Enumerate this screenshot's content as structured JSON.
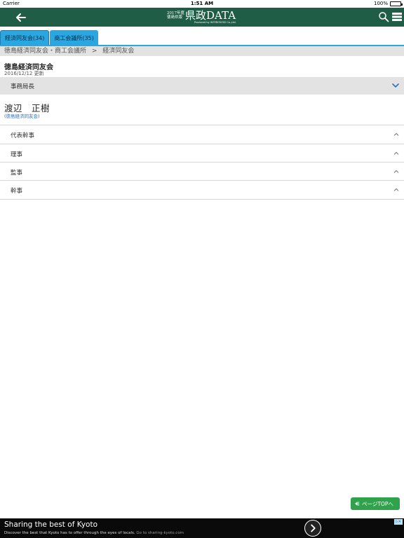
{
  "status": {
    "carrier": "Carrier",
    "time": "1:51 AM",
    "battery": "100%"
  },
  "header": {
    "logo_small_line1": "2017年度",
    "logo_small_line2": "徳島県版",
    "logo_big": "県政DATA",
    "logo_produced": "Produced by INTERCROSS Co.,Ltd."
  },
  "tabs": [
    {
      "label": "経済同友会(34)"
    },
    {
      "label": "商工会議所(35)"
    }
  ],
  "breadcrumb": {
    "parent": "徳島経済同友会・商工会議所",
    "separator": ">",
    "current": "経済同友会"
  },
  "org": {
    "title": "徳島経済同友会",
    "updated": "2016/12/12 更新"
  },
  "expanded_section": {
    "label": "事務局長",
    "person_name": "渡辺　正樹",
    "person_org_open": "(",
    "person_org_link": "徳島経済同友会",
    "person_org_close": ")"
  },
  "sections": [
    {
      "label": "代表幹事"
    },
    {
      "label": "理事"
    },
    {
      "label": "監事"
    },
    {
      "label": "幹事"
    }
  ],
  "page_top_label": "ページTOPへ",
  "ad": {
    "title": "Sharing the best of Kyoto",
    "desc": "Discover the best that Kyoto has to offer through the eyes of locals.",
    "url": "Go to sharing-kyoto.com"
  },
  "colors": {
    "navbar": "#1f5d47",
    "tab": "#29a7e1",
    "page_top": "#2fa24b",
    "link": "#2d70c9"
  }
}
